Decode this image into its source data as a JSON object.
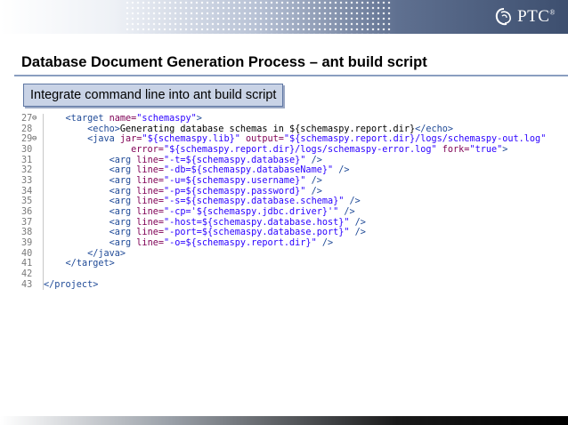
{
  "header": {
    "logo_text": "PTC",
    "logo_reg": "®"
  },
  "slide": {
    "title": "Database Document Generation Process – ant build script",
    "subtitle": "Integrate command line into ant build script"
  },
  "code": {
    "lines": [
      {
        "num": "27",
        "fold": "⊖",
        "html": "    <span class=\"tag\">&lt;target</span> <span class=\"attr\">name=</span><span class=\"str\">\"schemaspy\"</span><span class=\"tag\">&gt;</span>"
      },
      {
        "num": "28",
        "fold": "",
        "html": "        <span class=\"tag\">&lt;echo&gt;</span>Generating database schemas in ${schemaspy.report.dir}<span class=\"tag\">&lt;/echo&gt;</span>"
      },
      {
        "num": "29",
        "fold": "⊖",
        "html": "        <span class=\"tag\">&lt;java</span> <span class=\"attr\">jar=</span><span class=\"str\">\"${schemaspy.lib}\"</span> <span class=\"attr\">output=</span><span class=\"str\">\"${schemaspy.report.dir}/logs/schemaspy-out.log\"</span>"
      },
      {
        "num": "30",
        "fold": "",
        "html": "                <span class=\"attr\">error=</span><span class=\"str\">\"${schemaspy.report.dir}/logs/schemaspy-error.log\"</span> <span class=\"attr\">fork=</span><span class=\"str\">\"true\"</span><span class=\"tag\">&gt;</span>"
      },
      {
        "num": "31",
        "fold": "",
        "html": "            <span class=\"tag\">&lt;arg</span> <span class=\"attr\">line=</span><span class=\"str\">\"-t=${schemaspy.database}\"</span> <span class=\"tag\">/&gt;</span>"
      },
      {
        "num": "32",
        "fold": "",
        "html": "            <span class=\"tag\">&lt;arg</span> <span class=\"attr\">line=</span><span class=\"str\">\"-db=${schemaspy.databaseName}\"</span> <span class=\"tag\">/&gt;</span>"
      },
      {
        "num": "33",
        "fold": "",
        "html": "            <span class=\"tag\">&lt;arg</span> <span class=\"attr\">line=</span><span class=\"str\">\"-u=${schemaspy.username}\"</span> <span class=\"tag\">/&gt;</span>"
      },
      {
        "num": "34",
        "fold": "",
        "html": "            <span class=\"tag\">&lt;arg</span> <span class=\"attr\">line=</span><span class=\"str\">\"-p=${schemaspy.password}\"</span> <span class=\"tag\">/&gt;</span>"
      },
      {
        "num": "35",
        "fold": "",
        "html": "            <span class=\"tag\">&lt;arg</span> <span class=\"attr\">line=</span><span class=\"str\">\"-s=${schemaspy.database.schema}\"</span> <span class=\"tag\">/&gt;</span>"
      },
      {
        "num": "36",
        "fold": "",
        "html": "            <span class=\"tag\">&lt;arg</span> <span class=\"attr\">line=</span><span class=\"str\">\"-cp='${schemaspy.jdbc.driver}'\"</span> <span class=\"tag\">/&gt;</span>"
      },
      {
        "num": "37",
        "fold": "",
        "html": "            <span class=\"tag\">&lt;arg</span> <span class=\"attr\">line=</span><span class=\"str\">\"-host=${schemaspy.database.host}\"</span> <span class=\"tag\">/&gt;</span>"
      },
      {
        "num": "38",
        "fold": "",
        "html": "            <span class=\"tag\">&lt;arg</span> <span class=\"attr\">line=</span><span class=\"str\">\"-port=${schemaspy.database.port}\"</span> <span class=\"tag\">/&gt;</span>"
      },
      {
        "num": "39",
        "fold": "",
        "html": "            <span class=\"tag\">&lt;arg</span> <span class=\"attr\">line=</span><span class=\"str\">\"-o=${schemaspy.report.dir}\"</span> <span class=\"tag\">/&gt;</span>"
      },
      {
        "num": "40",
        "fold": "",
        "html": "        <span class=\"tag\">&lt;/java&gt;</span>"
      },
      {
        "num": "41",
        "fold": "",
        "html": "    <span class=\"tag\">&lt;/target&gt;</span>"
      },
      {
        "num": "42",
        "fold": "",
        "html": ""
      },
      {
        "num": "43",
        "fold": "",
        "html": "<span class=\"tag\">&lt;/project&gt;</span>"
      }
    ]
  }
}
